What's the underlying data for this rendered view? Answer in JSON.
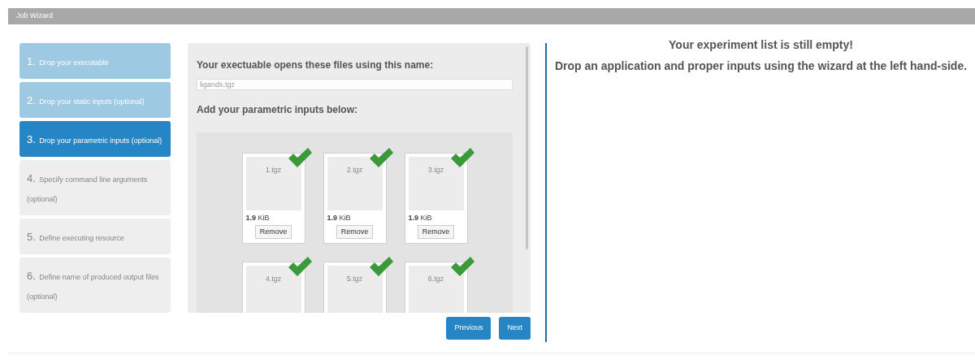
{
  "window": {
    "title": "Job Wizard"
  },
  "steps": [
    {
      "number": "1.",
      "label": "Drop your executable",
      "selected": false,
      "completed": true
    },
    {
      "number": "2.",
      "label": "Drop your static inputs (optional)",
      "selected": false,
      "completed": true
    },
    {
      "number": "3.",
      "label": "Drop your parametric inputs (optional)",
      "selected": true,
      "completed": false
    },
    {
      "number": "4.",
      "label": "Specify command line arguments (optional)",
      "selected": false,
      "completed": false
    },
    {
      "number": "5.",
      "label": "Define executing resource",
      "selected": false,
      "completed": false
    },
    {
      "number": "6.",
      "label": "Define name of produced output files (optional)",
      "selected": false,
      "completed": false
    }
  ],
  "panel": {
    "name_heading": "Your exectuable opens these files using this name:",
    "name_field": {
      "value": "ligands.tgz"
    },
    "inputs_heading": "Add your parametric inputs below:",
    "files": [
      {
        "name": "1.tgz",
        "uploaded": true,
        "size_number": "1.9",
        "size_unit": "KiB",
        "remove": "Remove"
      },
      {
        "name": "2.tgz",
        "uploaded": true,
        "size_number": "1.9",
        "size_unit": "KiB",
        "remove": "Remove"
      },
      {
        "name": "3.tgz",
        "uploaded": true,
        "size_number": "1.9",
        "size_unit": "KiB",
        "remove": "Remove"
      },
      {
        "name": "4.tgz",
        "uploaded": true
      },
      {
        "name": "5.tgz",
        "uploaded": true
      },
      {
        "name": "6.tgz",
        "uploaded": true
      }
    ]
  },
  "buttons": [
    "Previous",
    "Next"
  ],
  "message": [
    "Your experiment list is still empty!",
    "Drop an application and proper inputs using the wizard at the left hand-side."
  ]
}
